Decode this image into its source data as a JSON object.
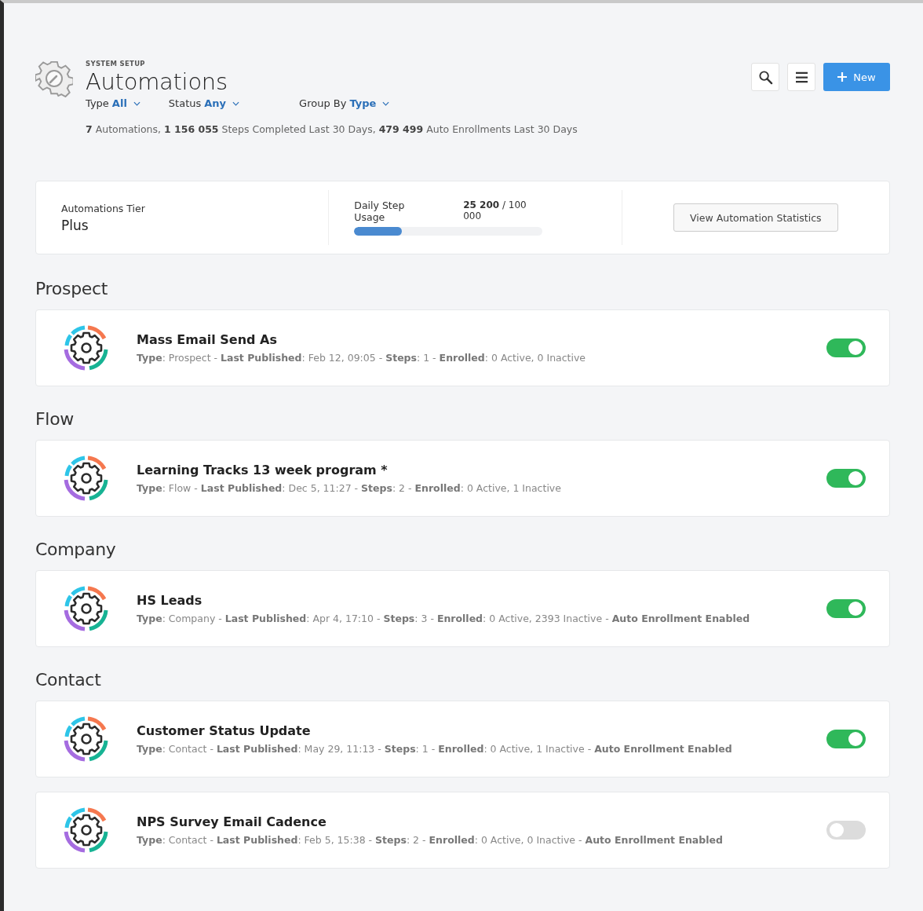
{
  "header": {
    "eyebrow": "SYSTEM SETUP",
    "title": "Automations",
    "filters": [
      {
        "label": "Type",
        "value": "All"
      },
      {
        "label": "Status",
        "value": "Any"
      },
      {
        "label": "Group By",
        "value": "Type"
      }
    ],
    "summary": "**7** Automations, **1 156 055** Steps Completed Last 30 Days, **479 499** Auto Enrollments Last 30 Days",
    "new_button": "New"
  },
  "tier_panel": {
    "tier_label": "Automations Tier",
    "tier_value": "Plus",
    "usage_label": "Daily Step Usage",
    "usage_reading": "**25 200** / 100 000",
    "level": 0.252,
    "stats_button": "View Automation Statistics"
  },
  "groups": [
    {
      "heading": "Prospect",
      "automations": [
        {
          "name": "Mass Email Send As",
          "details": "**Type**: Prospect - **Last Published**: Feb 12, 09:05 - **Steps**: 1 - **Enrolled**: 0 Active, 0 Inactive",
          "on": true
        }
      ]
    },
    {
      "heading": "Flow",
      "automations": [
        {
          "name": "Learning Tracks 13 week program *",
          "details": "**Type**: Flow - **Last Published**: Dec 5, 11:27 - **Steps**: 2 - **Enrolled**: 0 Active, 1 Inactive",
          "on": true
        }
      ]
    },
    {
      "heading": "Company",
      "automations": [
        {
          "name": "HS Leads",
          "details": "**Type**: Company - **Last Published**: Apr 4, 17:10 - **Steps**: 3 - **Enrolled**: 0 Active, 2393 Inactive - **Auto Enrollment Enabled**",
          "on": true
        }
      ]
    },
    {
      "heading": "Contact",
      "automations": [
        {
          "name": "Customer Status Update",
          "details": "**Type**: Contact - **Last Published**: May 29, 11:13 - **Steps**: 1 - **Enrolled**: 0 Active, 1 Inactive - **Auto Enrollment Enabled**",
          "on": true
        },
        {
          "name": "NPS Survey Email Cadence",
          "details": "**Type**: Contact - **Last Published**: Feb 5, 15:38 - **Steps**: 2 - **Enrolled**: 0 Active, 0 Inactive - **Auto Enrollment Enabled**",
          "on": false
        }
      ]
    }
  ]
}
